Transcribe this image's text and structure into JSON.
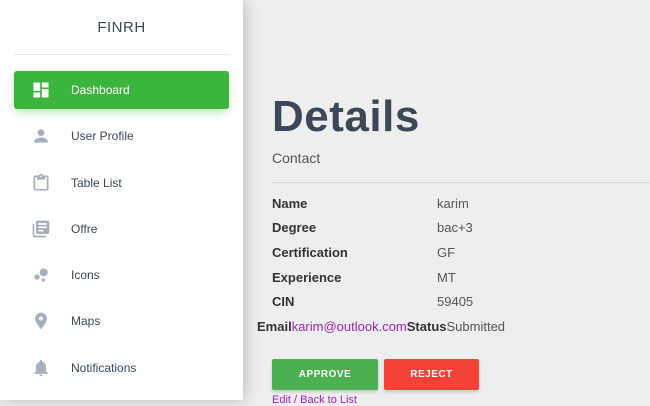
{
  "brand": "FINRH",
  "sidebar": {
    "items": [
      {
        "label": "Dashboard",
        "icon": "dashboard-icon",
        "active": true
      },
      {
        "label": "User Profile",
        "icon": "person-icon",
        "active": false
      },
      {
        "label": "Table List",
        "icon": "clipboard-icon",
        "active": false
      },
      {
        "label": "Offre",
        "icon": "library-books-icon",
        "active": false
      },
      {
        "label": "Icons",
        "icon": "bubble-chart-icon",
        "active": false
      },
      {
        "label": "Maps",
        "icon": "location-pin-icon",
        "active": false
      },
      {
        "label": "Notifications",
        "icon": "bell-icon",
        "active": false
      }
    ]
  },
  "main": {
    "title": "Details",
    "subtitle": "Contact",
    "details": [
      {
        "label": "Name",
        "value": "karim"
      },
      {
        "label": "Degree",
        "value": "bac+3"
      },
      {
        "label": "Certification",
        "value": "GF"
      },
      {
        "label": "Experience",
        "value": "MT"
      },
      {
        "label": "CIN",
        "value": "59405"
      }
    ],
    "email_label": "Email",
    "email_value": "karim@outlook.com",
    "status_label": "Status",
    "status_value": "Submitted",
    "approve_label": "APPROVE",
    "reject_label": "REJECT",
    "edit_link": "Edit / Back to List"
  },
  "colors": {
    "accent": "#3bb53b",
    "approve": "#4caf50",
    "reject": "#f44336",
    "link": "#9c27b0"
  }
}
